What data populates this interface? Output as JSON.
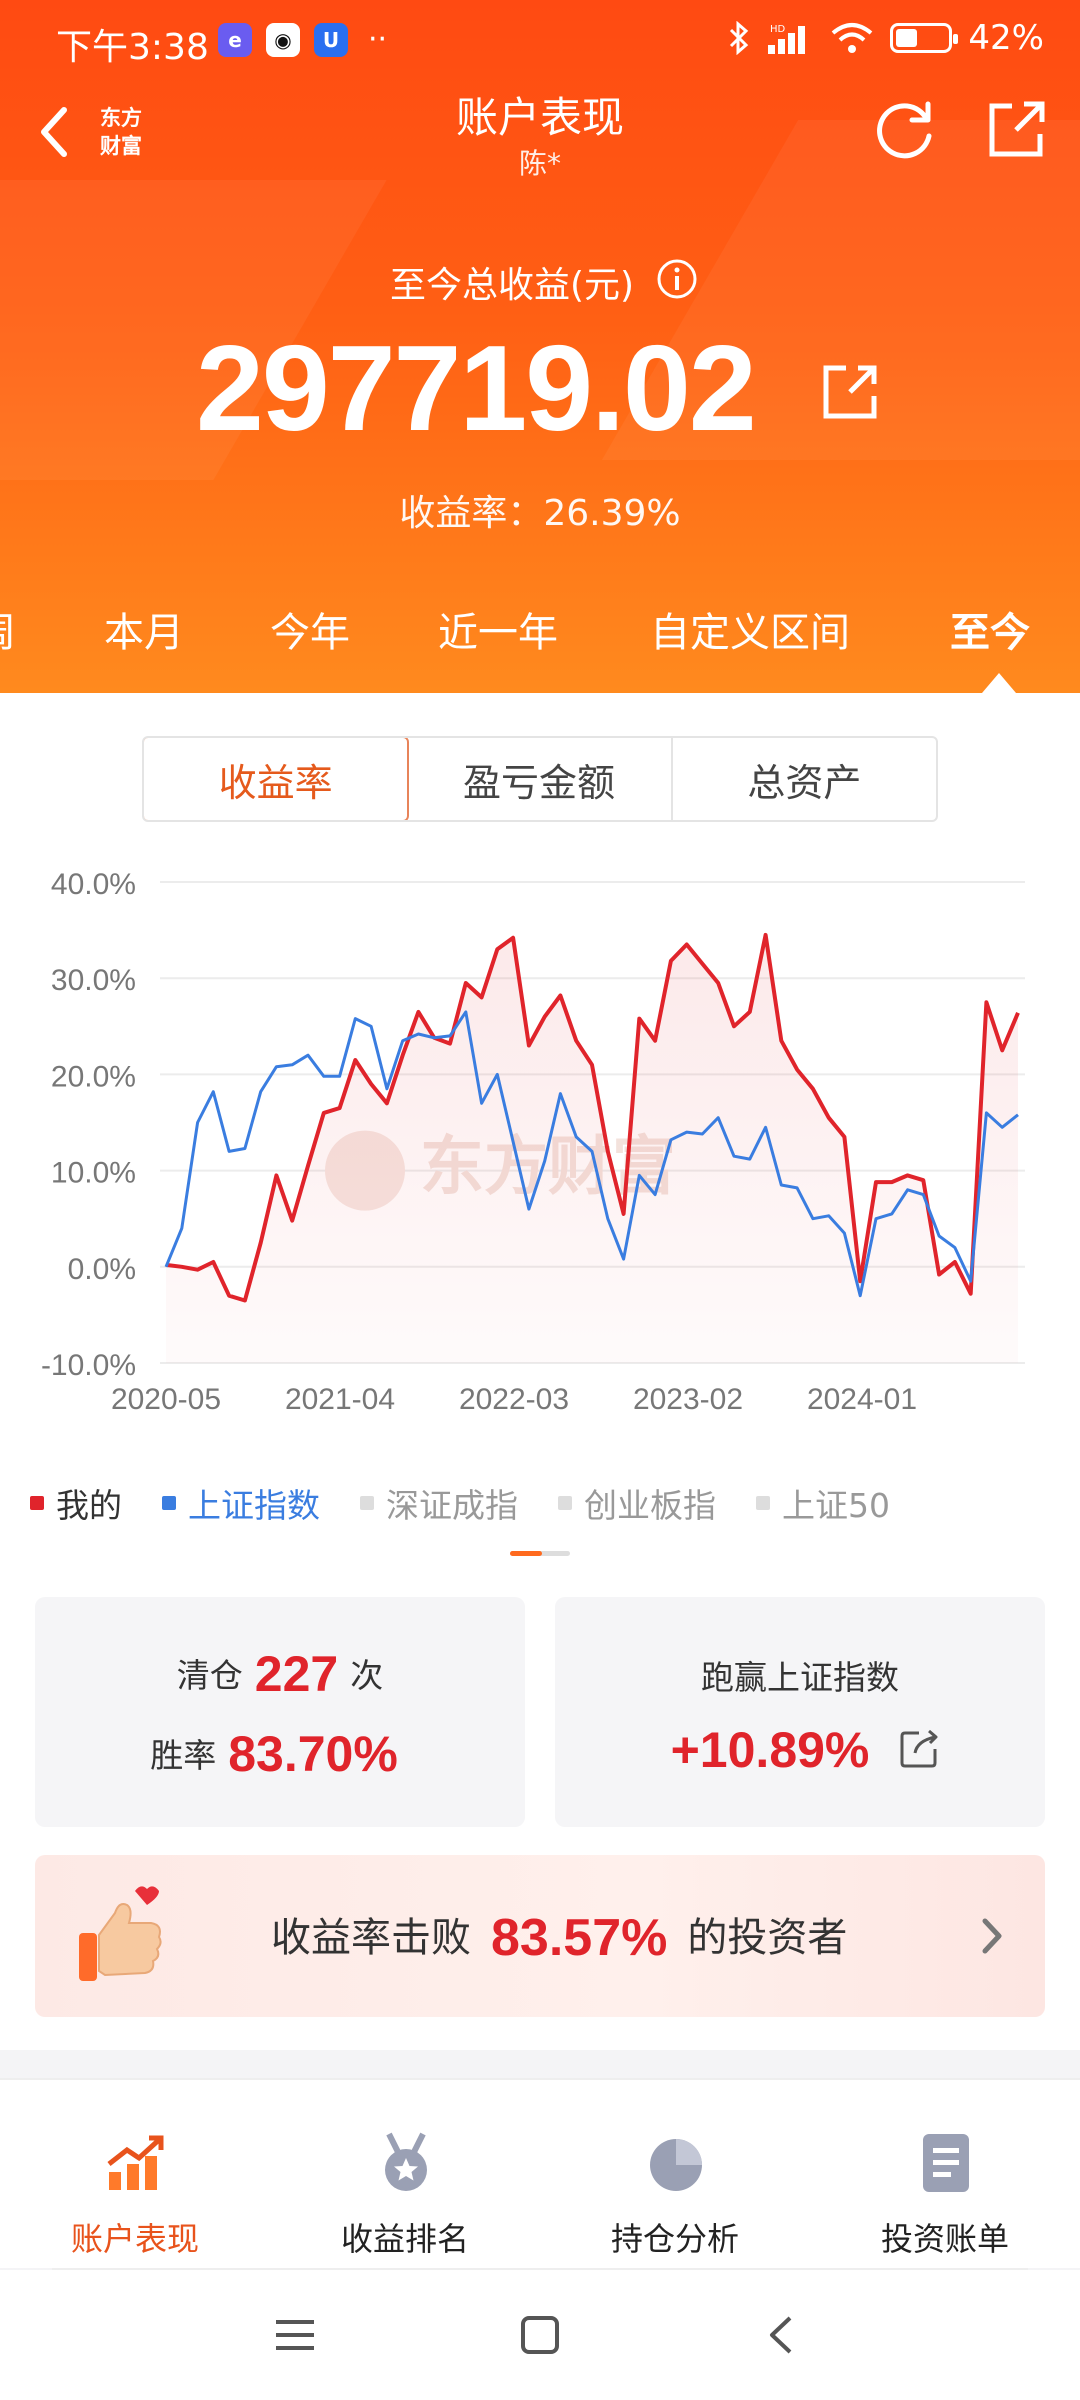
{
  "status_bar": {
    "time": "下午3:38",
    "battery_text": "42%",
    "battery_level": 0.42
  },
  "nav": {
    "brand": "东方财富",
    "title": "账户表现",
    "subtitle": "陈*"
  },
  "summary": {
    "total_label": "至今总收益(元)",
    "total_value": "297719.02",
    "rate_text": "收益率：26.39%"
  },
  "period_tabs": [
    "周",
    "本月",
    "今年",
    "近一年",
    "自定义区间",
    "至今"
  ],
  "active_period": "至今",
  "metric_tabs": [
    "收益率",
    "盈亏金额",
    "总资产"
  ],
  "active_metric": "收益率",
  "chart_data": {
    "type": "line",
    "x_ticks": [
      "2020-05",
      "2021-04",
      "2022-03",
      "2023-02",
      "2024-01"
    ],
    "y_ticks": [
      "-10.0%",
      "0.0%",
      "10.0%",
      "20.0%",
      "30.0%",
      "40.0%"
    ],
    "ylim": [
      -10,
      40
    ],
    "watermark": "东方财富",
    "series": [
      {
        "name": "我的",
        "color": "#e0242b",
        "values": [
          0.2,
          0.0,
          -0.3,
          0.5,
          -3.0,
          -3.5,
          2.5,
          9.5,
          4.8,
          10.5,
          16.0,
          16.5,
          21.5,
          19.0,
          17.0,
          22.0,
          26.5,
          23.8,
          23.2,
          29.5,
          28.0,
          33.0,
          34.2,
          23.0,
          26.0,
          28.2,
          23.5,
          21.0,
          12.0,
          5.5,
          25.8,
          23.5,
          31.8,
          33.5,
          31.5,
          29.5,
          25.0,
          26.5,
          34.5,
          23.5,
          20.5,
          18.5,
          15.5,
          13.5,
          -1.5,
          8.8,
          8.8,
          9.5,
          9.0,
          -0.8,
          0.5,
          -2.8,
          27.5,
          22.5,
          26.4
        ]
      },
      {
        "name": "上证指数",
        "color": "#3a7de0",
        "values": [
          0.0,
          4.0,
          15.0,
          18.2,
          12.0,
          12.3,
          18.2,
          20.8,
          21.0,
          22.0,
          19.8,
          19.8,
          25.8,
          25.0,
          18.5,
          23.5,
          24.2,
          23.8,
          24.0,
          26.5,
          17.0,
          20.0,
          13.0,
          6.0,
          11.0,
          18.0,
          13.5,
          12.0,
          5.0,
          0.8,
          9.5,
          7.5,
          13.2,
          14.0,
          13.8,
          15.5,
          11.5,
          11.2,
          14.5,
          8.5,
          8.2,
          5.0,
          5.3,
          3.5,
          -3.0,
          5.0,
          5.5,
          8.0,
          7.5,
          3.2,
          2.0,
          -1.5,
          16.0,
          14.5,
          15.8
        ]
      }
    ],
    "other_series_off": [
      "深证成指",
      "创业板指",
      "上证50"
    ]
  },
  "legend": {
    "mine": "我的",
    "sh": "上证指数",
    "sz": "深证成指",
    "cyb": "创业板指",
    "sz50": "上证50"
  },
  "stats": {
    "clear_prefix": "清仓",
    "clear_count": "227",
    "clear_suffix": "次",
    "win_label": "胜率",
    "win_rate": "83.70%",
    "beat_index_label": "跑赢上证指数",
    "beat_index_value": "+10.89%"
  },
  "beat_banner": {
    "prefix": "收益率击败",
    "value": "83.57%",
    "suffix": "的投资者"
  },
  "bottom_nav": [
    {
      "label": "账户表现",
      "icon": "chart-trend-icon",
      "active": true
    },
    {
      "label": "收益排名",
      "icon": "medal-icon",
      "active": false
    },
    {
      "label": "持仓分析",
      "icon": "pie-chart-icon",
      "active": false
    },
    {
      "label": "投资账单",
      "icon": "document-icon",
      "active": false
    }
  ]
}
